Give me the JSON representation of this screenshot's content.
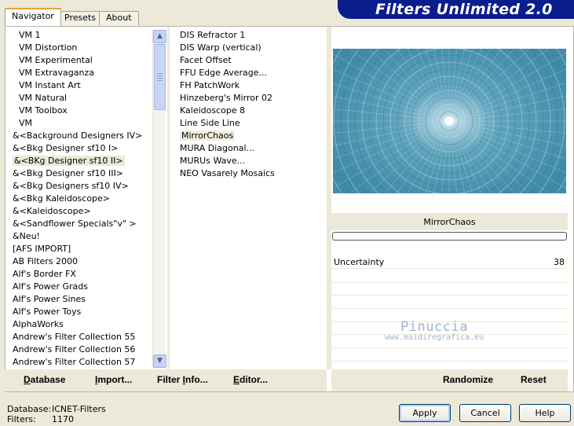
{
  "tabs": [
    "Navigator",
    "Presets",
    "About"
  ],
  "banner_title": "Filters Unlimited 2.0",
  "categories": [
    {
      "label": "VM 1",
      "indent": true
    },
    {
      "label": "VM Distortion",
      "indent": true
    },
    {
      "label": "VM Experimental",
      "indent": true
    },
    {
      "label": "VM Extravaganza",
      "indent": true
    },
    {
      "label": "VM Instant Art",
      "indent": true
    },
    {
      "label": "VM Natural",
      "indent": true
    },
    {
      "label": "VM Toolbox",
      "indent": true
    },
    {
      "label": "VM",
      "indent": true
    },
    {
      "label": "&<Background Designers IV>"
    },
    {
      "label": "&<Bkg Designer sf10 I>"
    },
    {
      "label": "&<BKg Designer sf10 II>",
      "selected": true
    },
    {
      "label": "&<Bkg Designer sf10 III>"
    },
    {
      "label": "&<Bkg Designers sf10 IV>"
    },
    {
      "label": "&<Bkg Kaleidoscope>"
    },
    {
      "label": "&<Kaleidoscope>"
    },
    {
      "label": "&<Sandflower Specials\"v\" >"
    },
    {
      "label": "&Neu!"
    },
    {
      "label": "[AFS IMPORT]"
    },
    {
      "label": "AB Filters 2000"
    },
    {
      "label": "Alf's Border FX"
    },
    {
      "label": "Alf's Power Grads"
    },
    {
      "label": "Alf's Power Sines"
    },
    {
      "label": "Alf's Power Toys"
    },
    {
      "label": "AlphaWorks"
    },
    {
      "label": "Andrew's Filter Collection 55"
    },
    {
      "label": "Andrew's Filter Collection 56"
    },
    {
      "label": "Andrew's Filter Collection 57"
    }
  ],
  "filters": [
    {
      "label": "DIS Refractor 1"
    },
    {
      "label": "DIS Warp (vertical)"
    },
    {
      "label": "Facet Offset"
    },
    {
      "label": "FFU Edge Average..."
    },
    {
      "label": "FH PatchWork"
    },
    {
      "label": "Hinzeberg's Mirror 02"
    },
    {
      "label": "Kaleidoscope 8"
    },
    {
      "label": "Line Side Line"
    },
    {
      "label": "MirrorChaos",
      "selected": true
    },
    {
      "label": "MURA Diagonal..."
    },
    {
      "label": "MURUs Wave..."
    },
    {
      "label": "NEO Vasarely Mosaics"
    }
  ],
  "selected_filter": "MirrorChaos",
  "progress": 0,
  "params": [
    {
      "name": "Uncertainty",
      "value": "38"
    }
  ],
  "watermark": {
    "line1": "Pinuccia",
    "line2": "www.maidiregrafica.eu"
  },
  "toolbar": {
    "database": {
      "ul": "D",
      "rest": "atabase"
    },
    "import": {
      "ul": "I",
      "rest": "mport..."
    },
    "filter_info": {
      "pre": "Filter ",
      "ul": "I",
      "rest": "nfo..."
    },
    "editor": {
      "ul": "E",
      "rest": "ditor..."
    },
    "randomize": "Randomize",
    "reset": "Reset"
  },
  "footer": {
    "database_label": "Database:",
    "database_value": "ICNET-Filters",
    "filters_label": "Filters:",
    "filters_value": "1170"
  },
  "buttons": {
    "apply": "Apply",
    "cancel": "Cancel",
    "help": "Help"
  },
  "colors": {
    "banner": "#0a1d8c",
    "accent_tab": "#e8a33a",
    "preview_base": "#4f98b3"
  }
}
